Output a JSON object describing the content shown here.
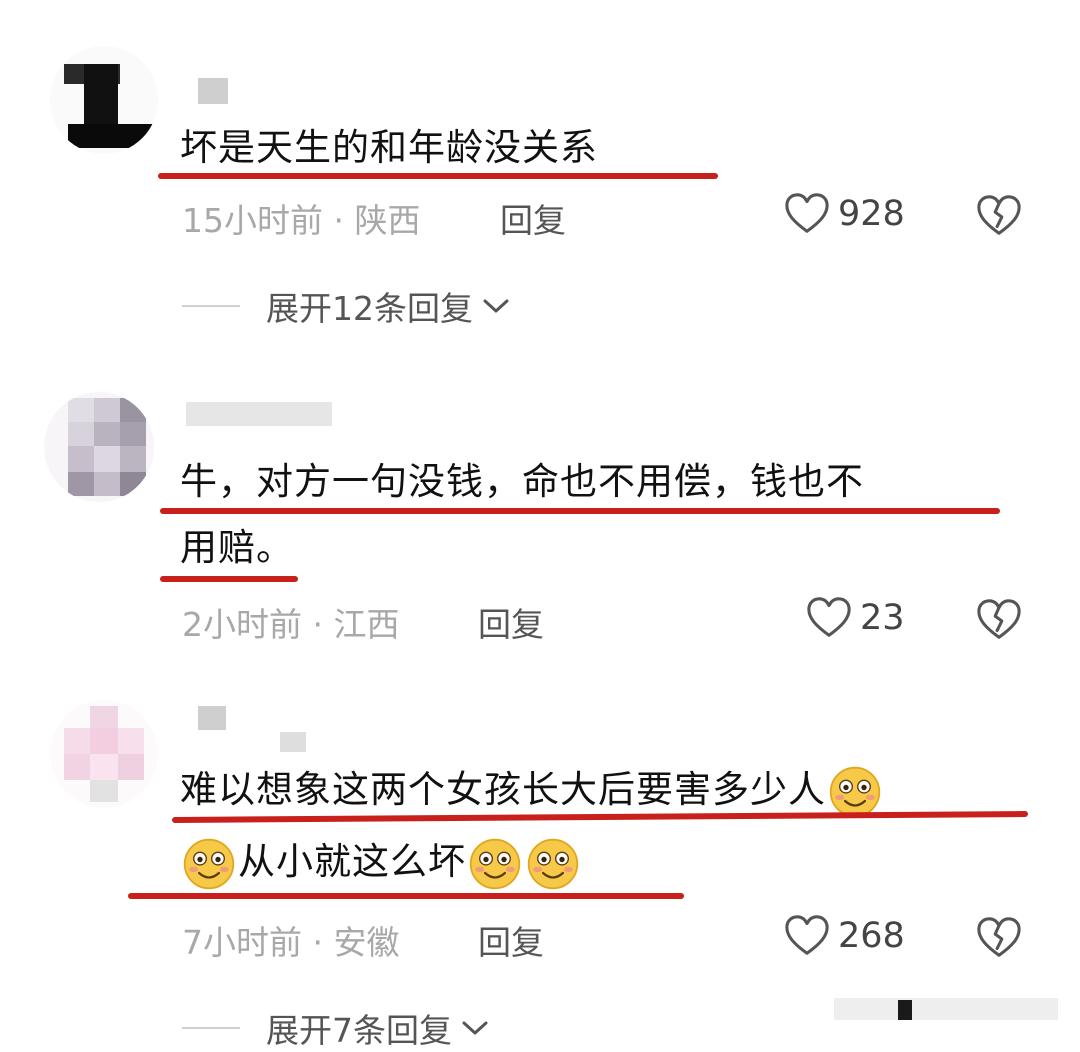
{
  "comments": [
    {
      "text": "坏是天生的和年龄没关系",
      "time": "15小时前",
      "location": "陕西",
      "reply_label": "回复",
      "likes": "928",
      "expand_label": "展开12条回复"
    },
    {
      "text_line1": "牛，对方一句没钱，命也不用偿，钱也不",
      "text_line2": "用赔。",
      "time": "2小时前",
      "location": "江西",
      "reply_label": "回复",
      "likes": "23"
    },
    {
      "text_line1": "难以想象这两个女孩长大后要害多少人",
      "text_line2": "从小就这么坏",
      "time": "7小时前",
      "location": "安徽",
      "reply_label": "回复",
      "likes": "268",
      "expand_label": "展开7条回复"
    }
  ],
  "separator": "·",
  "colors": {
    "underline": "#c8201a",
    "meta": "#a8a8a8"
  },
  "icons": [
    "heart-outline-icon",
    "broken-heart-icon",
    "chevron-down-icon",
    "smiling-face-emoji"
  ]
}
